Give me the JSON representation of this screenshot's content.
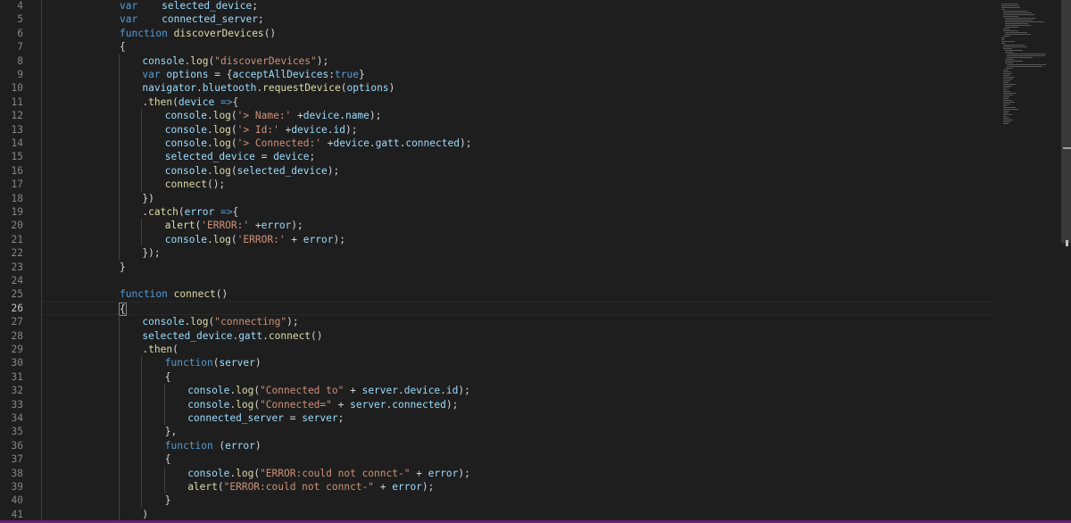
{
  "editor": {
    "current_line": 26,
    "lines": [
      {
        "n": 4,
        "indent": 1,
        "t": [
          [
            "kw",
            "var"
          ],
          [
            "pun",
            "    "
          ],
          [
            "id",
            "selected_device"
          ],
          [
            "pun",
            ";"
          ]
        ]
      },
      {
        "n": 5,
        "indent": 1,
        "t": [
          [
            "kw",
            "var"
          ],
          [
            "pun",
            "    "
          ],
          [
            "id",
            "connected_server"
          ],
          [
            "pun",
            ";"
          ]
        ]
      },
      {
        "n": 6,
        "indent": 1,
        "t": [
          [
            "kw",
            "function"
          ],
          [
            "pun",
            " "
          ],
          [
            "fn",
            "discoverDevices"
          ],
          [
            "pun",
            "()"
          ]
        ]
      },
      {
        "n": 7,
        "indent": 1,
        "t": [
          [
            "pun",
            "{"
          ]
        ]
      },
      {
        "n": 8,
        "indent": 2,
        "t": [
          [
            "id",
            "console"
          ],
          [
            "pun",
            "."
          ],
          [
            "fn",
            "log"
          ],
          [
            "pun",
            "("
          ],
          [
            "str",
            "\"discoverDevices\""
          ],
          [
            "pun",
            ");"
          ]
        ]
      },
      {
        "n": 9,
        "indent": 2,
        "t": [
          [
            "kw",
            "var"
          ],
          [
            "pun",
            " "
          ],
          [
            "id",
            "options"
          ],
          [
            "pun",
            " = {"
          ],
          [
            "id",
            "acceptAllDevices"
          ],
          [
            "pun",
            ":"
          ],
          [
            "kw",
            "true"
          ],
          [
            "pun",
            "}"
          ]
        ]
      },
      {
        "n": 10,
        "indent": 2,
        "t": [
          [
            "id",
            "navigator"
          ],
          [
            "pun",
            "."
          ],
          [
            "id",
            "bluetooth"
          ],
          [
            "pun",
            "."
          ],
          [
            "fn",
            "requestDevice"
          ],
          [
            "pun",
            "("
          ],
          [
            "id",
            "options"
          ],
          [
            "pun",
            ")"
          ]
        ]
      },
      {
        "n": 11,
        "indent": 2,
        "t": [
          [
            "pun",
            "."
          ],
          [
            "fn",
            "then"
          ],
          [
            "pun",
            "("
          ],
          [
            "id",
            "device"
          ],
          [
            "pun",
            " "
          ],
          [
            "kw",
            "=>"
          ],
          [
            "pun",
            "{"
          ]
        ]
      },
      {
        "n": 12,
        "indent": 3,
        "t": [
          [
            "id",
            "console"
          ],
          [
            "pun",
            "."
          ],
          [
            "fn",
            "log"
          ],
          [
            "pun",
            "("
          ],
          [
            "str",
            "'> Name:'"
          ],
          [
            "pun",
            " +"
          ],
          [
            "id",
            "device"
          ],
          [
            "pun",
            "."
          ],
          [
            "id",
            "name"
          ],
          [
            "pun",
            ");"
          ]
        ]
      },
      {
        "n": 13,
        "indent": 3,
        "t": [
          [
            "id",
            "console"
          ],
          [
            "pun",
            "."
          ],
          [
            "fn",
            "log"
          ],
          [
            "pun",
            "("
          ],
          [
            "str",
            "'> Id:'"
          ],
          [
            "pun",
            " +"
          ],
          [
            "id",
            "device"
          ],
          [
            "pun",
            "."
          ],
          [
            "id",
            "id"
          ],
          [
            "pun",
            ");"
          ]
        ]
      },
      {
        "n": 14,
        "indent": 3,
        "t": [
          [
            "id",
            "console"
          ],
          [
            "pun",
            "."
          ],
          [
            "fn",
            "log"
          ],
          [
            "pun",
            "("
          ],
          [
            "str",
            "'> Connected:'"
          ],
          [
            "pun",
            " +"
          ],
          [
            "id",
            "device"
          ],
          [
            "pun",
            "."
          ],
          [
            "id",
            "gatt"
          ],
          [
            "pun",
            "."
          ],
          [
            "id",
            "connected"
          ],
          [
            "pun",
            ");"
          ]
        ]
      },
      {
        "n": 15,
        "indent": 3,
        "t": [
          [
            "id",
            "selected_device"
          ],
          [
            "pun",
            " = "
          ],
          [
            "id",
            "device"
          ],
          [
            "pun",
            ";"
          ]
        ]
      },
      {
        "n": 16,
        "indent": 3,
        "t": [
          [
            "id",
            "console"
          ],
          [
            "pun",
            "."
          ],
          [
            "fn",
            "log"
          ],
          [
            "pun",
            "("
          ],
          [
            "id",
            "selected_device"
          ],
          [
            "pun",
            ");"
          ]
        ]
      },
      {
        "n": 17,
        "indent": 3,
        "t": [
          [
            "fn",
            "connect"
          ],
          [
            "pun",
            "();"
          ]
        ]
      },
      {
        "n": 18,
        "indent": 2,
        "t": [
          [
            "pun",
            "})"
          ]
        ]
      },
      {
        "n": 19,
        "indent": 2,
        "t": [
          [
            "pun",
            "."
          ],
          [
            "fn",
            "catch"
          ],
          [
            "pun",
            "("
          ],
          [
            "id",
            "error"
          ],
          [
            "pun",
            " "
          ],
          [
            "kw",
            "=>"
          ],
          [
            "pun",
            "{"
          ]
        ]
      },
      {
        "n": 20,
        "indent": 3,
        "t": [
          [
            "fn",
            "alert"
          ],
          [
            "pun",
            "("
          ],
          [
            "str",
            "'ERROR:'"
          ],
          [
            "pun",
            " +"
          ],
          [
            "id",
            "error"
          ],
          [
            "pun",
            ");"
          ]
        ]
      },
      {
        "n": 21,
        "indent": 3,
        "t": [
          [
            "id",
            "console"
          ],
          [
            "pun",
            "."
          ],
          [
            "fn",
            "log"
          ],
          [
            "pun",
            "("
          ],
          [
            "str",
            "'ERROR:'"
          ],
          [
            "pun",
            " + "
          ],
          [
            "id",
            "error"
          ],
          [
            "pun",
            ");"
          ]
        ]
      },
      {
        "n": 22,
        "indent": 2,
        "t": [
          [
            "pun",
            "});"
          ]
        ]
      },
      {
        "n": 23,
        "indent": 1,
        "t": [
          [
            "pun",
            "}"
          ]
        ]
      },
      {
        "n": 24,
        "indent": 1,
        "t": []
      },
      {
        "n": 25,
        "indent": 1,
        "t": [
          [
            "kw",
            "function"
          ],
          [
            "pun",
            " "
          ],
          [
            "fn",
            "connect"
          ],
          [
            "pun",
            "()"
          ]
        ]
      },
      {
        "n": 26,
        "indent": 1,
        "t": [
          [
            "pun",
            "{"
          ]
        ]
      },
      {
        "n": 27,
        "indent": 2,
        "t": [
          [
            "id",
            "console"
          ],
          [
            "pun",
            "."
          ],
          [
            "fn",
            "log"
          ],
          [
            "pun",
            "("
          ],
          [
            "str",
            "\"connecting\""
          ],
          [
            "pun",
            ");"
          ]
        ]
      },
      {
        "n": 28,
        "indent": 2,
        "t": [
          [
            "id",
            "selected_device"
          ],
          [
            "pun",
            "."
          ],
          [
            "id",
            "gatt"
          ],
          [
            "pun",
            "."
          ],
          [
            "fn",
            "connect"
          ],
          [
            "pun",
            "()"
          ]
        ]
      },
      {
        "n": 29,
        "indent": 2,
        "t": [
          [
            "pun",
            "."
          ],
          [
            "fn",
            "then"
          ],
          [
            "pun",
            "("
          ]
        ]
      },
      {
        "n": 30,
        "indent": 3,
        "t": [
          [
            "kw",
            "function"
          ],
          [
            "pun",
            "("
          ],
          [
            "id",
            "server"
          ],
          [
            "pun",
            ")"
          ]
        ]
      },
      {
        "n": 31,
        "indent": 3,
        "t": [
          [
            "pun",
            "{"
          ]
        ]
      },
      {
        "n": 32,
        "indent": 4,
        "t": [
          [
            "id",
            "console"
          ],
          [
            "pun",
            "."
          ],
          [
            "fn",
            "log"
          ],
          [
            "pun",
            "("
          ],
          [
            "str",
            "\"Connected to\""
          ],
          [
            "pun",
            " + "
          ],
          [
            "id",
            "server"
          ],
          [
            "pun",
            "."
          ],
          [
            "id",
            "device"
          ],
          [
            "pun",
            "."
          ],
          [
            "id",
            "id"
          ],
          [
            "pun",
            ");"
          ]
        ]
      },
      {
        "n": 33,
        "indent": 4,
        "t": [
          [
            "id",
            "console"
          ],
          [
            "pun",
            "."
          ],
          [
            "fn",
            "log"
          ],
          [
            "pun",
            "("
          ],
          [
            "str",
            "\"Connected=\""
          ],
          [
            "pun",
            " + "
          ],
          [
            "id",
            "server"
          ],
          [
            "pun",
            "."
          ],
          [
            "id",
            "connected"
          ],
          [
            "pun",
            ");"
          ]
        ]
      },
      {
        "n": 34,
        "indent": 4,
        "t": [
          [
            "id",
            "connected_server"
          ],
          [
            "pun",
            " = "
          ],
          [
            "id",
            "server"
          ],
          [
            "pun",
            ";"
          ]
        ]
      },
      {
        "n": 35,
        "indent": 3,
        "t": [
          [
            "pun",
            "},"
          ]
        ]
      },
      {
        "n": 36,
        "indent": 3,
        "t": [
          [
            "kw",
            "function"
          ],
          [
            "pun",
            " ("
          ],
          [
            "id",
            "error"
          ],
          [
            "pun",
            ")"
          ]
        ]
      },
      {
        "n": 37,
        "indent": 3,
        "t": [
          [
            "pun",
            "{"
          ]
        ]
      },
      {
        "n": 38,
        "indent": 4,
        "t": [
          [
            "id",
            "console"
          ],
          [
            "pun",
            "."
          ],
          [
            "fn",
            "log"
          ],
          [
            "pun",
            "("
          ],
          [
            "str",
            "\"ERROR:could not connct-\""
          ],
          [
            "pun",
            " + "
          ],
          [
            "id",
            "error"
          ],
          [
            "pun",
            ");"
          ]
        ]
      },
      {
        "n": 39,
        "indent": 4,
        "t": [
          [
            "fn",
            "alert"
          ],
          [
            "pun",
            "("
          ],
          [
            "str",
            "\"ERROR:could not connct-\""
          ],
          [
            "pun",
            " + "
          ],
          [
            "id",
            "error"
          ],
          [
            "pun",
            ");"
          ]
        ]
      },
      {
        "n": 40,
        "indent": 3,
        "t": [
          [
            "pun",
            "}"
          ]
        ]
      },
      {
        "n": 41,
        "indent": 2,
        "t": [
          [
            "pun",
            ")"
          ]
        ]
      }
    ]
  },
  "colors": {
    "background": "#1e1e1e",
    "keyword": "#569cd6",
    "identifier": "#9cdcfe",
    "function": "#dcdcaa",
    "string": "#ce9178",
    "line_number": "#858585",
    "status_bar": "#68217a"
  }
}
